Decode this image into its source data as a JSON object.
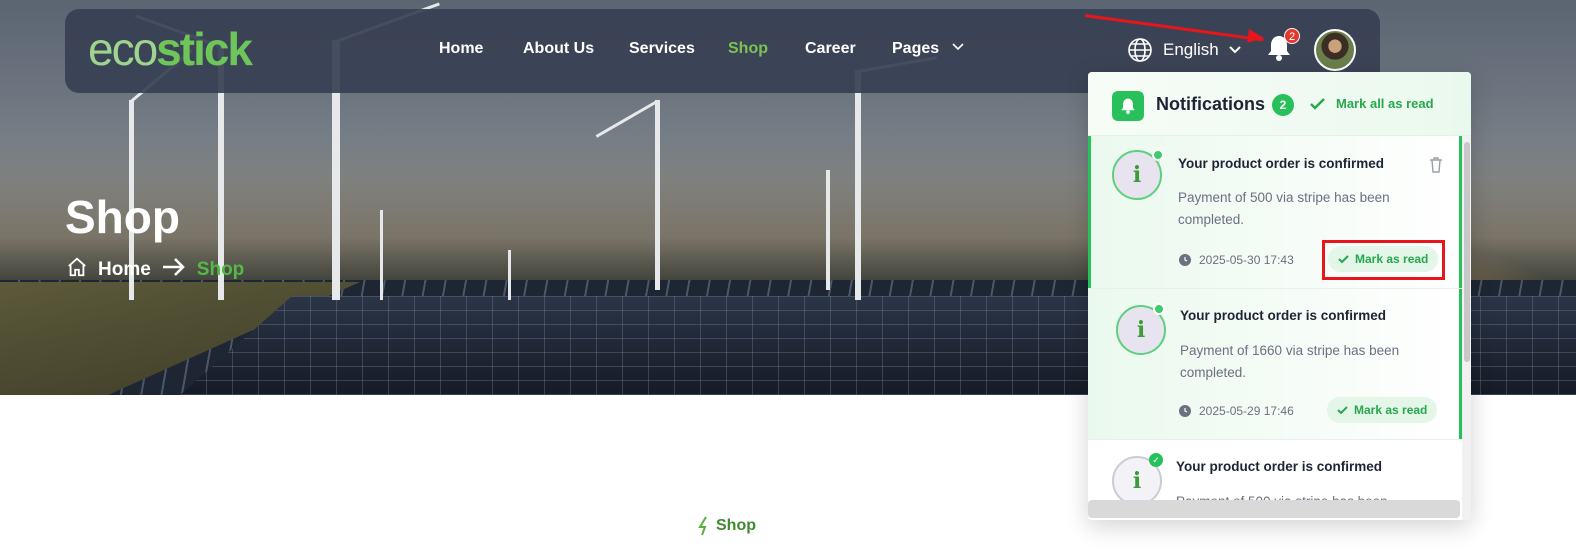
{
  "brand": {
    "logo_part1": "eco",
    "logo_part2": "stick",
    "accent": "#6ec65a"
  },
  "nav": {
    "items": [
      "Home",
      "About Us",
      "Services",
      "Shop",
      "Career",
      "Pages"
    ],
    "active": "Shop"
  },
  "header": {
    "language": "English",
    "notification_count": "2"
  },
  "hero": {
    "title": "Shop",
    "breadcrumb_home": "Home",
    "breadcrumb_current": "Shop"
  },
  "section": {
    "tag": "Shop"
  },
  "notifications": {
    "title": "Notifications",
    "count": "2",
    "mark_all_label": "Mark all as read",
    "items": [
      {
        "title": "Your product order is confirmed",
        "body": "Payment of 500 via stripe has been completed.",
        "time": "2025-05-30 17:43",
        "action": "Mark as read",
        "status": "unread"
      },
      {
        "title": "Your product order is confirmed",
        "body": "Payment of 1660 via stripe has been completed.",
        "time": "2025-05-29 17:46",
        "action": "Mark as read",
        "status": "unread"
      },
      {
        "title": "Your product order is confirmed",
        "body": "Payment of 500 via stripe has been",
        "status": "read"
      }
    ]
  },
  "colors": {
    "green": "#27c05a",
    "red_annotation": "#e8151b",
    "nav_bg": "#374052"
  },
  "icons": [
    "globe-icon",
    "chevron-down-icon",
    "bell-icon",
    "home-icon",
    "arrow-right-icon",
    "check-icon",
    "double-check-icon",
    "clock-icon",
    "trash-icon",
    "info-icon",
    "bolt-icon"
  ]
}
